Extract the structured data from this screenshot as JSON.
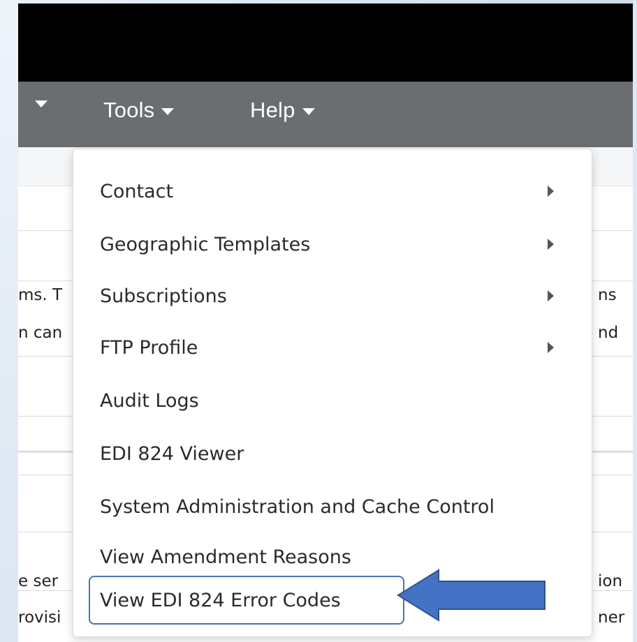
{
  "nav": {
    "prev_label": "",
    "tools_label": "Tools",
    "help_label": "Help"
  },
  "background_text": {
    "line1_left": "ms. T",
    "line1_right": "ns",
    "line2_left": "n can",
    "line2_right": "nd",
    "line3_left": "e ser",
    "line3_right": "ion",
    "line4_left": "rovisi",
    "line4_right": "ner"
  },
  "menu": {
    "items": [
      {
        "label": "Contact",
        "has_submenu": true
      },
      {
        "label": "Geographic Templates",
        "has_submenu": true
      },
      {
        "label": "Subscriptions",
        "has_submenu": true
      },
      {
        "label": "FTP Profile",
        "has_submenu": true
      },
      {
        "label": "Audit Logs",
        "has_submenu": false
      },
      {
        "label": "EDI 824 Viewer",
        "has_submenu": false
      },
      {
        "label": "System Administration and Cache Control",
        "has_submenu": false
      },
      {
        "label": "View Amendment Reasons",
        "has_submenu": false
      },
      {
        "label": "View EDI 824 Error Codes",
        "has_submenu": false
      }
    ]
  },
  "colors": {
    "topbar": "#000000",
    "navbar": "#6b6e71",
    "highlight_border": "#4a72b8",
    "arrow_fill": "#4472c4",
    "arrow_stroke": "#2f528f"
  },
  "annotation": {
    "highlighted_item": "View EDI 824 Error Codes",
    "arrow_icon": "left-arrow-icon"
  }
}
